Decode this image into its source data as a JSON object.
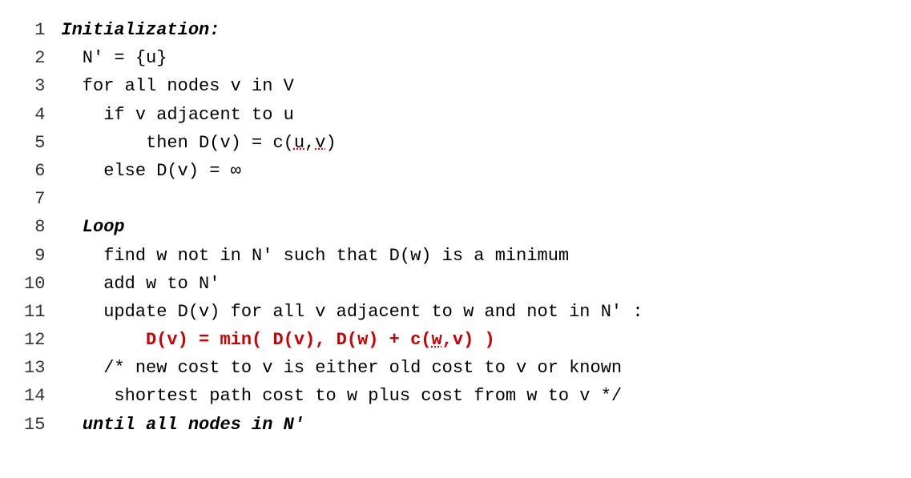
{
  "lines": [
    {
      "number": "1",
      "segments": [
        {
          "text": "Initialization:",
          "style": "bold-italic"
        }
      ]
    },
    {
      "number": "2",
      "segments": [
        {
          "text": "  N' = {u}",
          "style": "normal"
        }
      ]
    },
    {
      "number": "3",
      "segments": [
        {
          "text": "  for all nodes v in V",
          "style": "normal"
        }
      ]
    },
    {
      "number": "4",
      "segments": [
        {
          "text": "    if v adjacent to u",
          "style": "normal"
        }
      ]
    },
    {
      "number": "5",
      "segments": [
        {
          "text": "        then D(v) = c(",
          "style": "normal"
        },
        {
          "text": "u",
          "style": "underline-dotted"
        },
        {
          "text": ",",
          "style": "normal"
        },
        {
          "text": "v",
          "style": "underline-dotted"
        },
        {
          "text": ")",
          "style": "normal"
        }
      ]
    },
    {
      "number": "6",
      "segments": [
        {
          "text": "    else D(v) = ∞",
          "style": "normal"
        }
      ]
    },
    {
      "number": "7",
      "segments": [
        {
          "text": "",
          "style": "normal"
        }
      ]
    },
    {
      "number": "8",
      "segments": [
        {
          "text": "  Loop",
          "style": "bold-italic"
        }
      ]
    },
    {
      "number": "9",
      "segments": [
        {
          "text": "    find w not in N' such that D(w) is a minimum",
          "style": "normal"
        }
      ]
    },
    {
      "number": "10",
      "segments": [
        {
          "text": "    add w to N'",
          "style": "normal"
        }
      ]
    },
    {
      "number": "11",
      "segments": [
        {
          "text": "    update D(v) for all v adjacent to w and not in N' :",
          "style": "normal"
        }
      ]
    },
    {
      "number": "12",
      "segments": [
        {
          "text": "        ",
          "style": "normal"
        },
        {
          "text": "D(v) = min( D(v), D(w) + c(",
          "style": "red-bold"
        },
        {
          "text": "w",
          "style": "red-bold-underline"
        },
        {
          "text": ",v) )",
          "style": "red-bold"
        }
      ]
    },
    {
      "number": "13",
      "segments": [
        {
          "text": "    /* new cost to v is either old cost to v or known",
          "style": "normal"
        }
      ]
    },
    {
      "number": "14",
      "segments": [
        {
          "text": "     shortest path cost to w plus cost from w to v */",
          "style": "normal"
        }
      ]
    },
    {
      "number": "15",
      "segments": [
        {
          "text": "  until all nodes in N'",
          "style": "bold-italic"
        }
      ]
    }
  ]
}
